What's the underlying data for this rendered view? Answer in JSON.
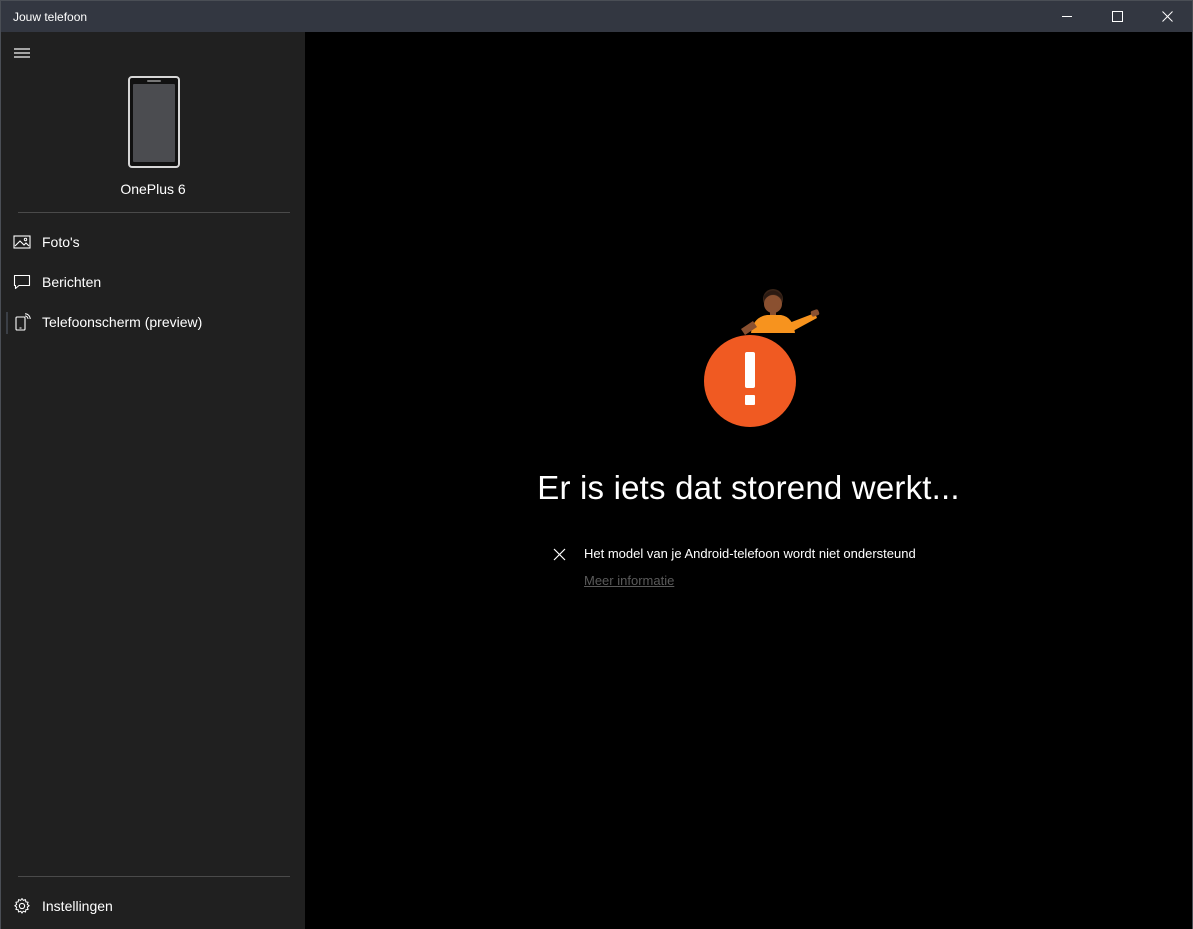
{
  "window": {
    "title": "Jouw telefoon"
  },
  "sidebar": {
    "device_name": "OnePlus 6",
    "items": [
      {
        "label": "Foto's",
        "icon": "photos-icon"
      },
      {
        "label": "Berichten",
        "icon": "messages-icon"
      },
      {
        "label": "Telefoonscherm (preview)",
        "icon": "phone-screen-icon",
        "active": true
      }
    ],
    "settings_label": "Instellingen"
  },
  "main": {
    "headline": "Er is iets dat storend werkt...",
    "issue_text": "Het model van je Android-telefoon wordt niet ondersteund",
    "more_info_link": "Meer informatie"
  },
  "colors": {
    "titlebar": "#333741",
    "sidebar": "#202020",
    "main_bg": "#000000",
    "alert_orange": "#f05a22",
    "link_gray": "#5a5a5a"
  }
}
